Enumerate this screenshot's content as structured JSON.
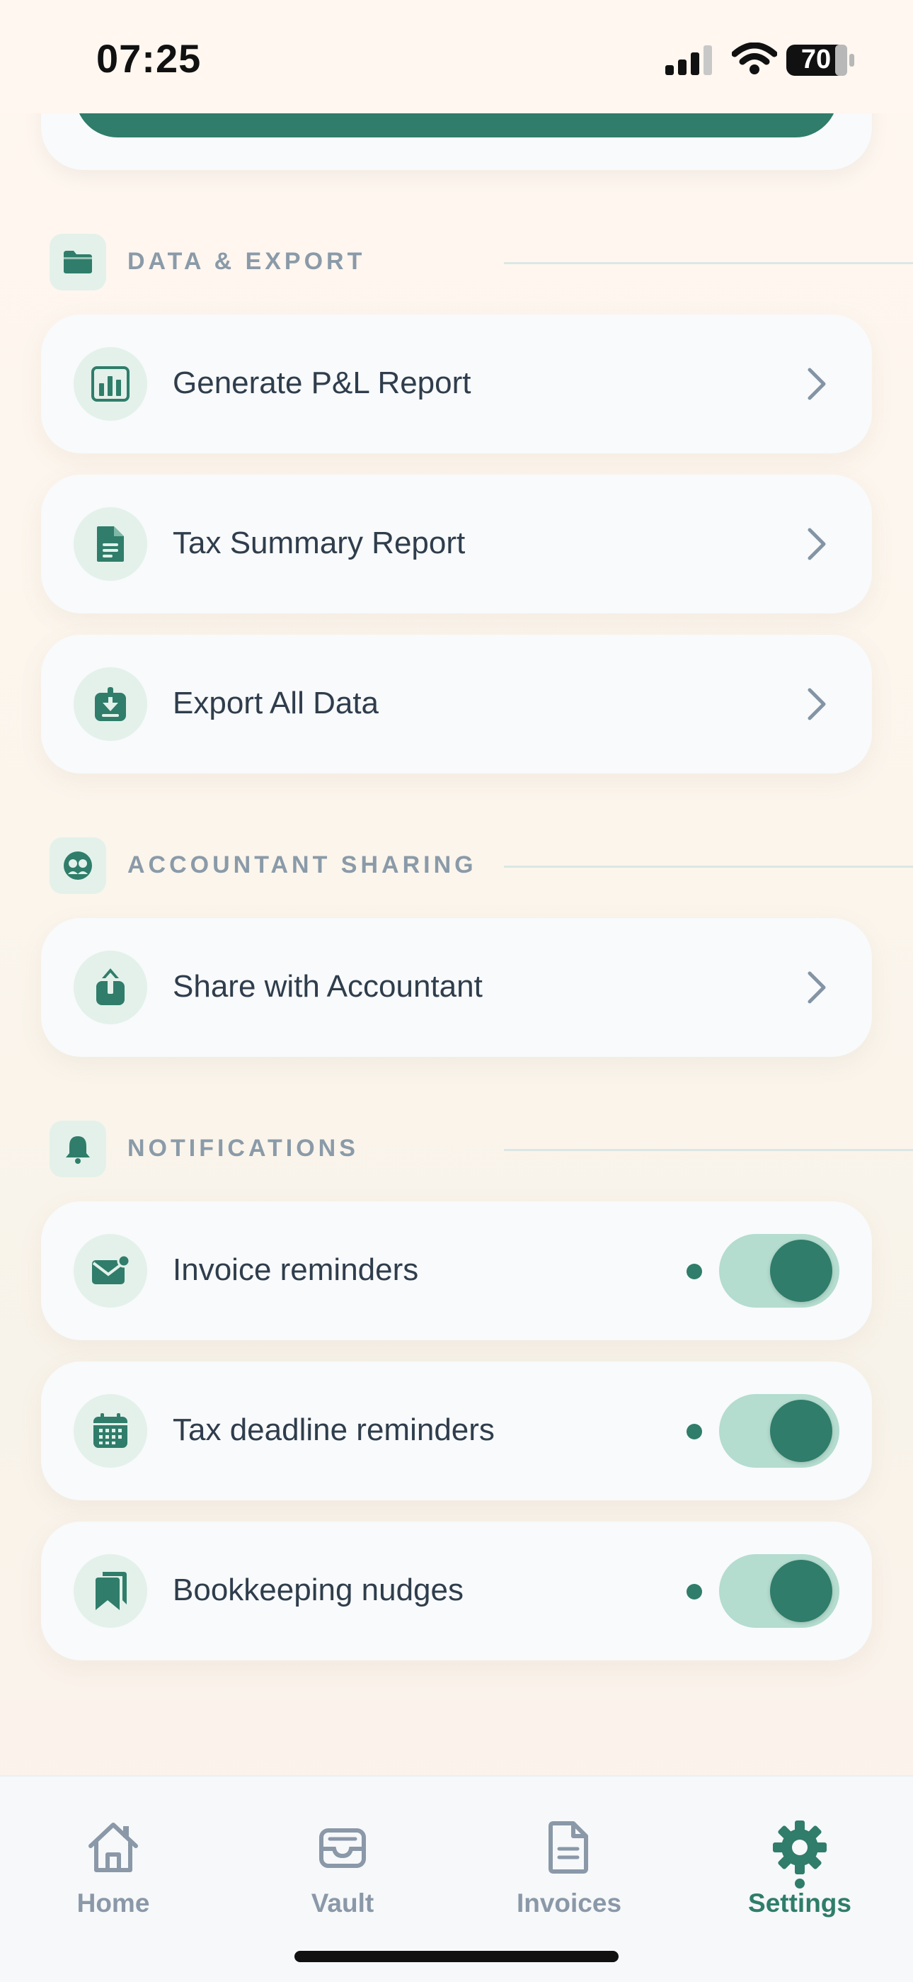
{
  "status_bar": {
    "time": "07:25",
    "battery": "70"
  },
  "sections": {
    "data_export": {
      "title": "DATA & EXPORT",
      "icon": "folder-icon",
      "items": [
        {
          "label": "Generate P&L Report",
          "icon": "bar-chart-icon"
        },
        {
          "label": "Tax Summary Report",
          "icon": "document-icon"
        },
        {
          "label": "Export All Data",
          "icon": "download-tray-icon"
        }
      ]
    },
    "accountant_sharing": {
      "title": "ACCOUNTANT SHARING",
      "icon": "people-icon",
      "items": [
        {
          "label": "Share with Accountant",
          "icon": "share-icon"
        }
      ]
    },
    "notifications": {
      "title": "NOTIFICATIONS",
      "icon": "bell-icon",
      "items": [
        {
          "label": "Invoice reminders",
          "icon": "mail-badge-icon",
          "enabled": true
        },
        {
          "label": "Tax deadline reminders",
          "icon": "calendar-icon",
          "enabled": true
        },
        {
          "label": "Bookkeeping nudges",
          "icon": "bookmarks-icon",
          "enabled": true
        }
      ]
    }
  },
  "tab_bar": {
    "tabs": [
      {
        "label": "Home",
        "icon": "house-icon",
        "active": false
      },
      {
        "label": "Vault",
        "icon": "inbox-tray-icon",
        "active": false
      },
      {
        "label": "Invoices",
        "icon": "document-icon",
        "active": false
      },
      {
        "label": "Settings",
        "icon": "gear-icon",
        "active": true
      }
    ]
  },
  "colors": {
    "accent": "#2f7d6a",
    "accent_light": "#e3f1ea",
    "toggle_track": "#b4dccf",
    "section_title": "#8a9aa8",
    "background": "#fdf6ef"
  }
}
